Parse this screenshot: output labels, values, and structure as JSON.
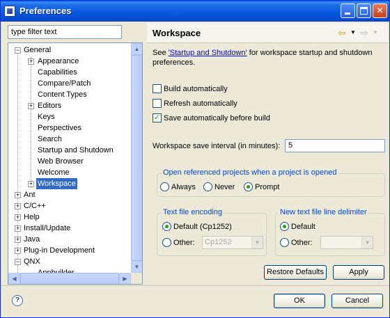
{
  "window": {
    "title": "Preferences"
  },
  "filter": {
    "placeholder": "type filter text"
  },
  "tree": {
    "items": [
      {
        "label": "General",
        "depth": 0,
        "expander": "minus"
      },
      {
        "label": "Appearance",
        "depth": 1,
        "expander": "plus"
      },
      {
        "label": "Capabilities",
        "depth": 1,
        "expander": ""
      },
      {
        "label": "Compare/Patch",
        "depth": 1,
        "expander": ""
      },
      {
        "label": "Content Types",
        "depth": 1,
        "expander": ""
      },
      {
        "label": "Editors",
        "depth": 1,
        "expander": "plus"
      },
      {
        "label": "Keys",
        "depth": 1,
        "expander": ""
      },
      {
        "label": "Perspectives",
        "depth": 1,
        "expander": ""
      },
      {
        "label": "Search",
        "depth": 1,
        "expander": ""
      },
      {
        "label": "Startup and Shutdown",
        "depth": 1,
        "expander": ""
      },
      {
        "label": "Web Browser",
        "depth": 1,
        "expander": ""
      },
      {
        "label": "Welcome",
        "depth": 1,
        "expander": ""
      },
      {
        "label": "Workspace",
        "depth": 1,
        "expander": "plus",
        "selected": true
      },
      {
        "label": "Ant",
        "depth": 0,
        "expander": "plus"
      },
      {
        "label": "C/C++",
        "depth": 0,
        "expander": "plus"
      },
      {
        "label": "Help",
        "depth": 0,
        "expander": "plus"
      },
      {
        "label": "Install/Update",
        "depth": 0,
        "expander": "plus"
      },
      {
        "label": "Java",
        "depth": 0,
        "expander": "plus"
      },
      {
        "label": "Plug-in Development",
        "depth": 0,
        "expander": "plus"
      },
      {
        "label": "QNX",
        "depth": 0,
        "expander": "minus"
      },
      {
        "label": "Appbuilder",
        "depth": 1,
        "expander": ""
      }
    ]
  },
  "page": {
    "title": "Workspace",
    "desc_prefix": "See ",
    "desc_link": "'Startup and Shutdown'",
    "desc_suffix": " for workspace startup and shutdown preferences.",
    "build_auto": "Build automatically",
    "refresh_auto": "Refresh automatically",
    "save_auto": "Save automatically before build",
    "save_auto_checked": true,
    "interval_label": "Workspace save interval (in minutes):",
    "interval_value": "5",
    "open_group_title": "Open referenced projects when a project is opened",
    "opt_always": "Always",
    "opt_never": "Never",
    "opt_prompt": "Prompt",
    "encoding_title": "Text file encoding",
    "enc_default": "Default (Cp1252)",
    "enc_other": "Other:",
    "enc_other_value": "Cp1252",
    "delim_title": "New text file line delimiter",
    "delim_default": "Default",
    "delim_other": "Other:",
    "restore_defaults": "Restore Defaults",
    "apply": "Apply"
  },
  "footer": {
    "ok": "OK",
    "cancel": "Cancel"
  },
  "colors": {
    "titlebar": "#0858e0",
    "selection": "#316ac5",
    "link": "#0000cc",
    "check": "#21a121"
  }
}
